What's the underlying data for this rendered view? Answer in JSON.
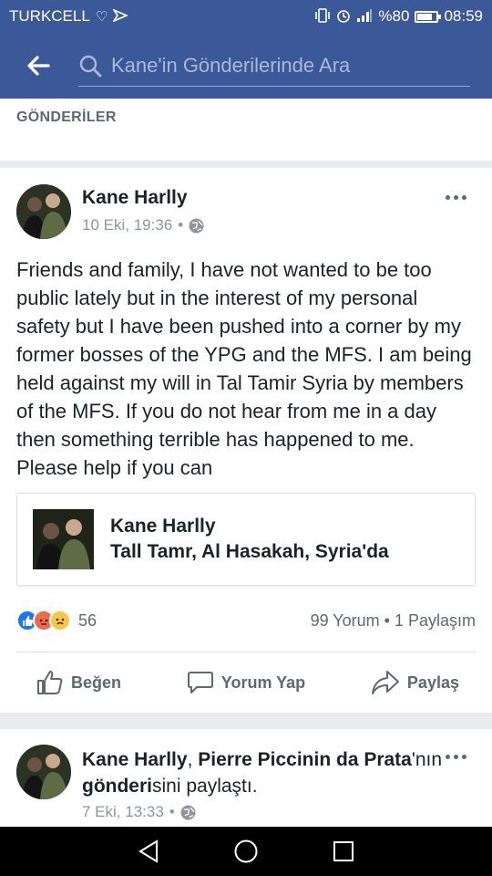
{
  "status_bar": {
    "carrier": "TURKCELL",
    "battery": "%80",
    "battery_level": 0.8,
    "time": "08:59"
  },
  "search": {
    "placeholder": "Kane'in Gönderilerinde Ara"
  },
  "section": {
    "title": "GÖNDERİLER"
  },
  "post": {
    "author": "Kane Harlly",
    "time": "10 Eki, 19:36",
    "separator": "•",
    "text": "Friends and family, I have not wanted to be too public lately but in the interest of my personal safety but I have been pushed into a corner by my former bosses of the YPG and the MFS. I am being held against my will in Tal Tamir Syria by members of the MFS. If you do not hear from me in a day then something terrible has happened to me. Please help if you can",
    "checkin": {
      "name": "Kane Harlly",
      "place": "Tall Tamr, Al Hasakah, Syria'da"
    },
    "reactions_count": "56",
    "stats": "99 Yorum • 1 Paylaşım",
    "actions": {
      "like": "Beğen",
      "comment": "Yorum Yap",
      "share": "Paylaş"
    }
  },
  "post2": {
    "author": "Kane Harlly",
    "comma": ",",
    "other": "Pierre Piccinin da Prata",
    "possessive": "'nın",
    "post_word": "gönderi",
    "suffix": "sini paylaştı.",
    "time": "7 Eki, 13:33",
    "separator": "•"
  },
  "colors": {
    "brand": "#3b5998",
    "like_blue": "#1877f2",
    "angry": "#f0694a",
    "sad": "#f7c843"
  }
}
